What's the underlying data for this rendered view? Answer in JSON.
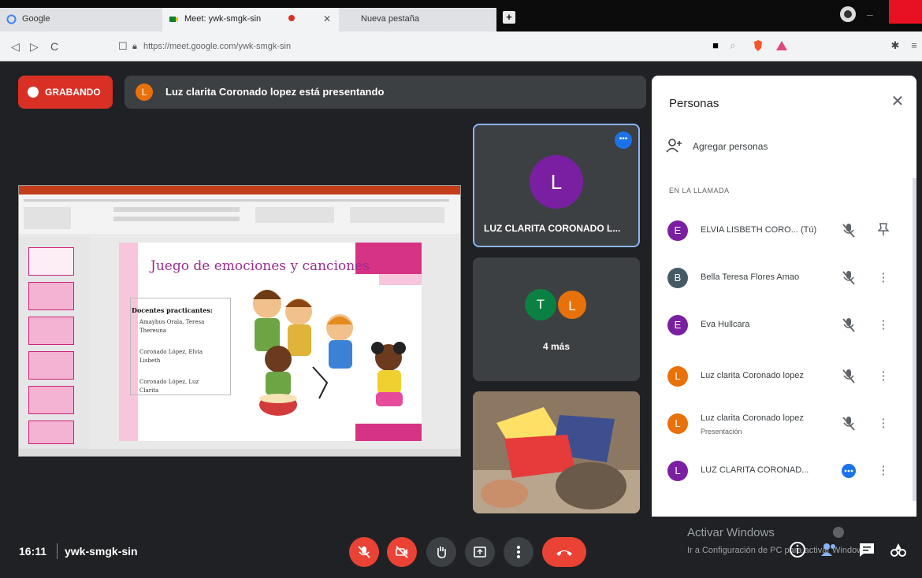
{
  "browser": {
    "tabs": [
      {
        "label": "Google"
      },
      {
        "label": "Meet: ywk-smgk-sin"
      },
      {
        "label": "Nueva pestaña"
      }
    ],
    "url": "https://meet.google.com/ywk-smgk-sin"
  },
  "meet": {
    "recording_label": "GRABANDO",
    "presenting_avatar": "L",
    "presenting_text": "Luz clarita Coronado lopez está presentando",
    "slide": {
      "title": "Juego de emociones y canciones",
      "heading": "Docentes practicantes:",
      "items": [
        "Amaybus Orala, Teresa Thereuna",
        "Coronado López, Elvia Lisbeth",
        "Coronado López, Luz Clarita"
      ]
    },
    "tiles": {
      "main_avatar": "L",
      "main_name": "LUZ CLARITA CORONADO L...",
      "group_avatars": [
        "T",
        "L"
      ],
      "group_count": "4 más"
    }
  },
  "people_panel": {
    "title": "Personas",
    "add_label": "Agregar personas",
    "section_label": "EN LA LLAMADA",
    "people": [
      {
        "initial": "E",
        "name": "ELVIA LISBETH CORO... (Tú)",
        "sub": "",
        "color": "#7b1fa2",
        "action": "pin"
      },
      {
        "initial": "B",
        "name": "Bella Teresa Flores Amao",
        "sub": "",
        "color": "#455a64",
        "action": "more"
      },
      {
        "initial": "E",
        "name": "Eva Hullcara",
        "sub": "",
        "color": "#7b1fa2",
        "action": "more"
      },
      {
        "initial": "L",
        "name": "Luz clarita Coronado lopez",
        "sub": "",
        "color": "#e8710a",
        "action": "more"
      },
      {
        "initial": "L",
        "name": "Luz clarita Coronado lopez",
        "sub": "Presentación",
        "color": "#e8710a",
        "action": "more"
      },
      {
        "initial": "L",
        "name": "LUZ CLARITA CORONAD...",
        "sub": "",
        "color": "#7b1fa2",
        "action": "more"
      }
    ]
  },
  "bottom": {
    "time": "16:11",
    "meeting_code": "ywk-smgk-sin",
    "watermark_title": "Activar Windows",
    "watermark_sub": "Ir a Configuración de PC para activar Windows."
  }
}
